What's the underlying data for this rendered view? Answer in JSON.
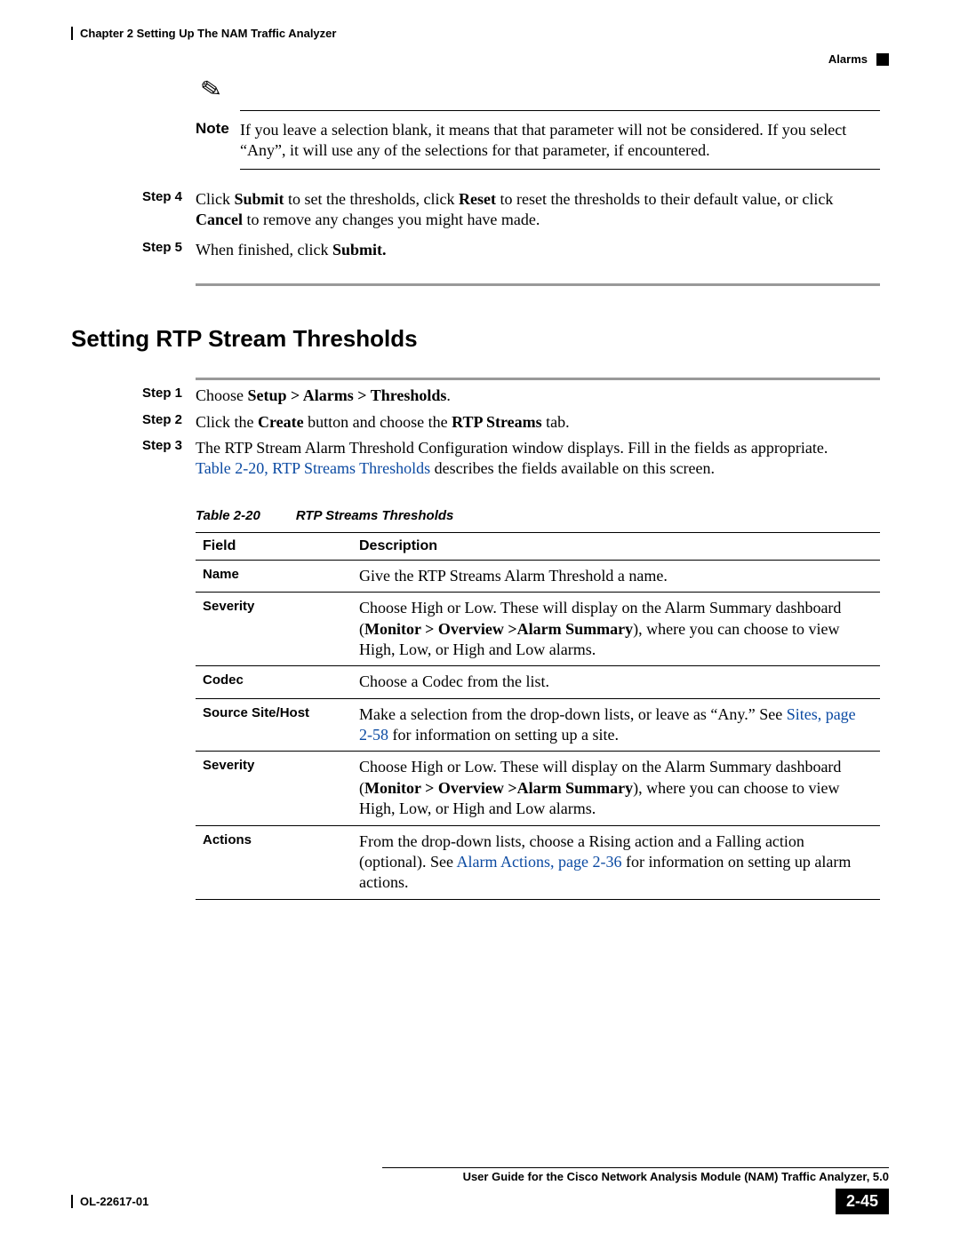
{
  "header": {
    "chapter": "Chapter 2      Setting Up The NAM Traffic Analyzer",
    "section": "Alarms"
  },
  "note": {
    "label": "Note",
    "text": "If you leave a selection blank, it means that that parameter will not be considered. If you select “Any”, it will use any of the selections for that parameter, if encountered."
  },
  "steps_top": [
    {
      "label": "Step 4",
      "parts": [
        "Click ",
        "Submit",
        " to set the thresholds, click ",
        "Reset",
        " to reset the thresholds to their default value, or click ",
        "Cancel",
        " to remove any changes you might have made."
      ]
    },
    {
      "label": "Step 5",
      "parts": [
        "When finished, click ",
        "Submit."
      ]
    }
  ],
  "heading": "Setting RTP Stream Thresholds",
  "steps_main": [
    {
      "label": "Step 1",
      "parts": [
        "Choose ",
        "Setup > Alarms > Thresholds",
        "."
      ]
    },
    {
      "label": "Step 2",
      "parts": [
        "Click the ",
        "Create",
        " button and choose the ",
        "RTP Streams",
        " tab."
      ]
    },
    {
      "label": "Step 3",
      "parts": [
        "The RTP Stream Alarm Threshold Configuration window displays. Fill in the fields as appropriate. "
      ],
      "link": "Table 2-20, RTP Streams Thresholds",
      "tail": " describes the fields available on this screen."
    }
  ],
  "table": {
    "caption_num": "Table 2-20",
    "caption_title": "RTP Streams Thresholds",
    "headers": [
      "Field",
      "Description"
    ],
    "rows": [
      {
        "field": "Name",
        "desc": [
          "Give the RTP Streams Alarm Threshold a name."
        ]
      },
      {
        "field": "Severity",
        "desc": [
          "Choose High or Low. These will display on the Alarm Summary dashboard (",
          "Monitor > Overview >Alarm Summary",
          "), where you can choose to view High, Low, or High and Low alarms."
        ]
      },
      {
        "field": "Codec",
        "desc": [
          "Choose a Codec from the list."
        ]
      },
      {
        "field": "Source Site/Host",
        "desc_pre": "Make a selection from the drop-down lists, or leave as “Any.” See ",
        "link": "Sites, page 2-58",
        "desc_post": " for information on setting up a site."
      },
      {
        "field": "Severity",
        "desc": [
          "Choose High or Low. These will display on the Alarm Summary dashboard (",
          "Monitor > Overview >Alarm Summary",
          "), where you can choose to view High, Low, or High and Low alarms."
        ]
      },
      {
        "field": "Actions",
        "desc_pre": "From the drop-down lists, choose a Rising action and a Falling action (optional). See ",
        "link": "Alarm Actions, page 2-36",
        "desc_post": " for information on setting up alarm actions."
      }
    ]
  },
  "footer": {
    "title": "User Guide for the Cisco Network Analysis Module (NAM) Traffic Analyzer, 5.0",
    "docnum": "OL-22617-01",
    "pagenum": "2-45"
  }
}
